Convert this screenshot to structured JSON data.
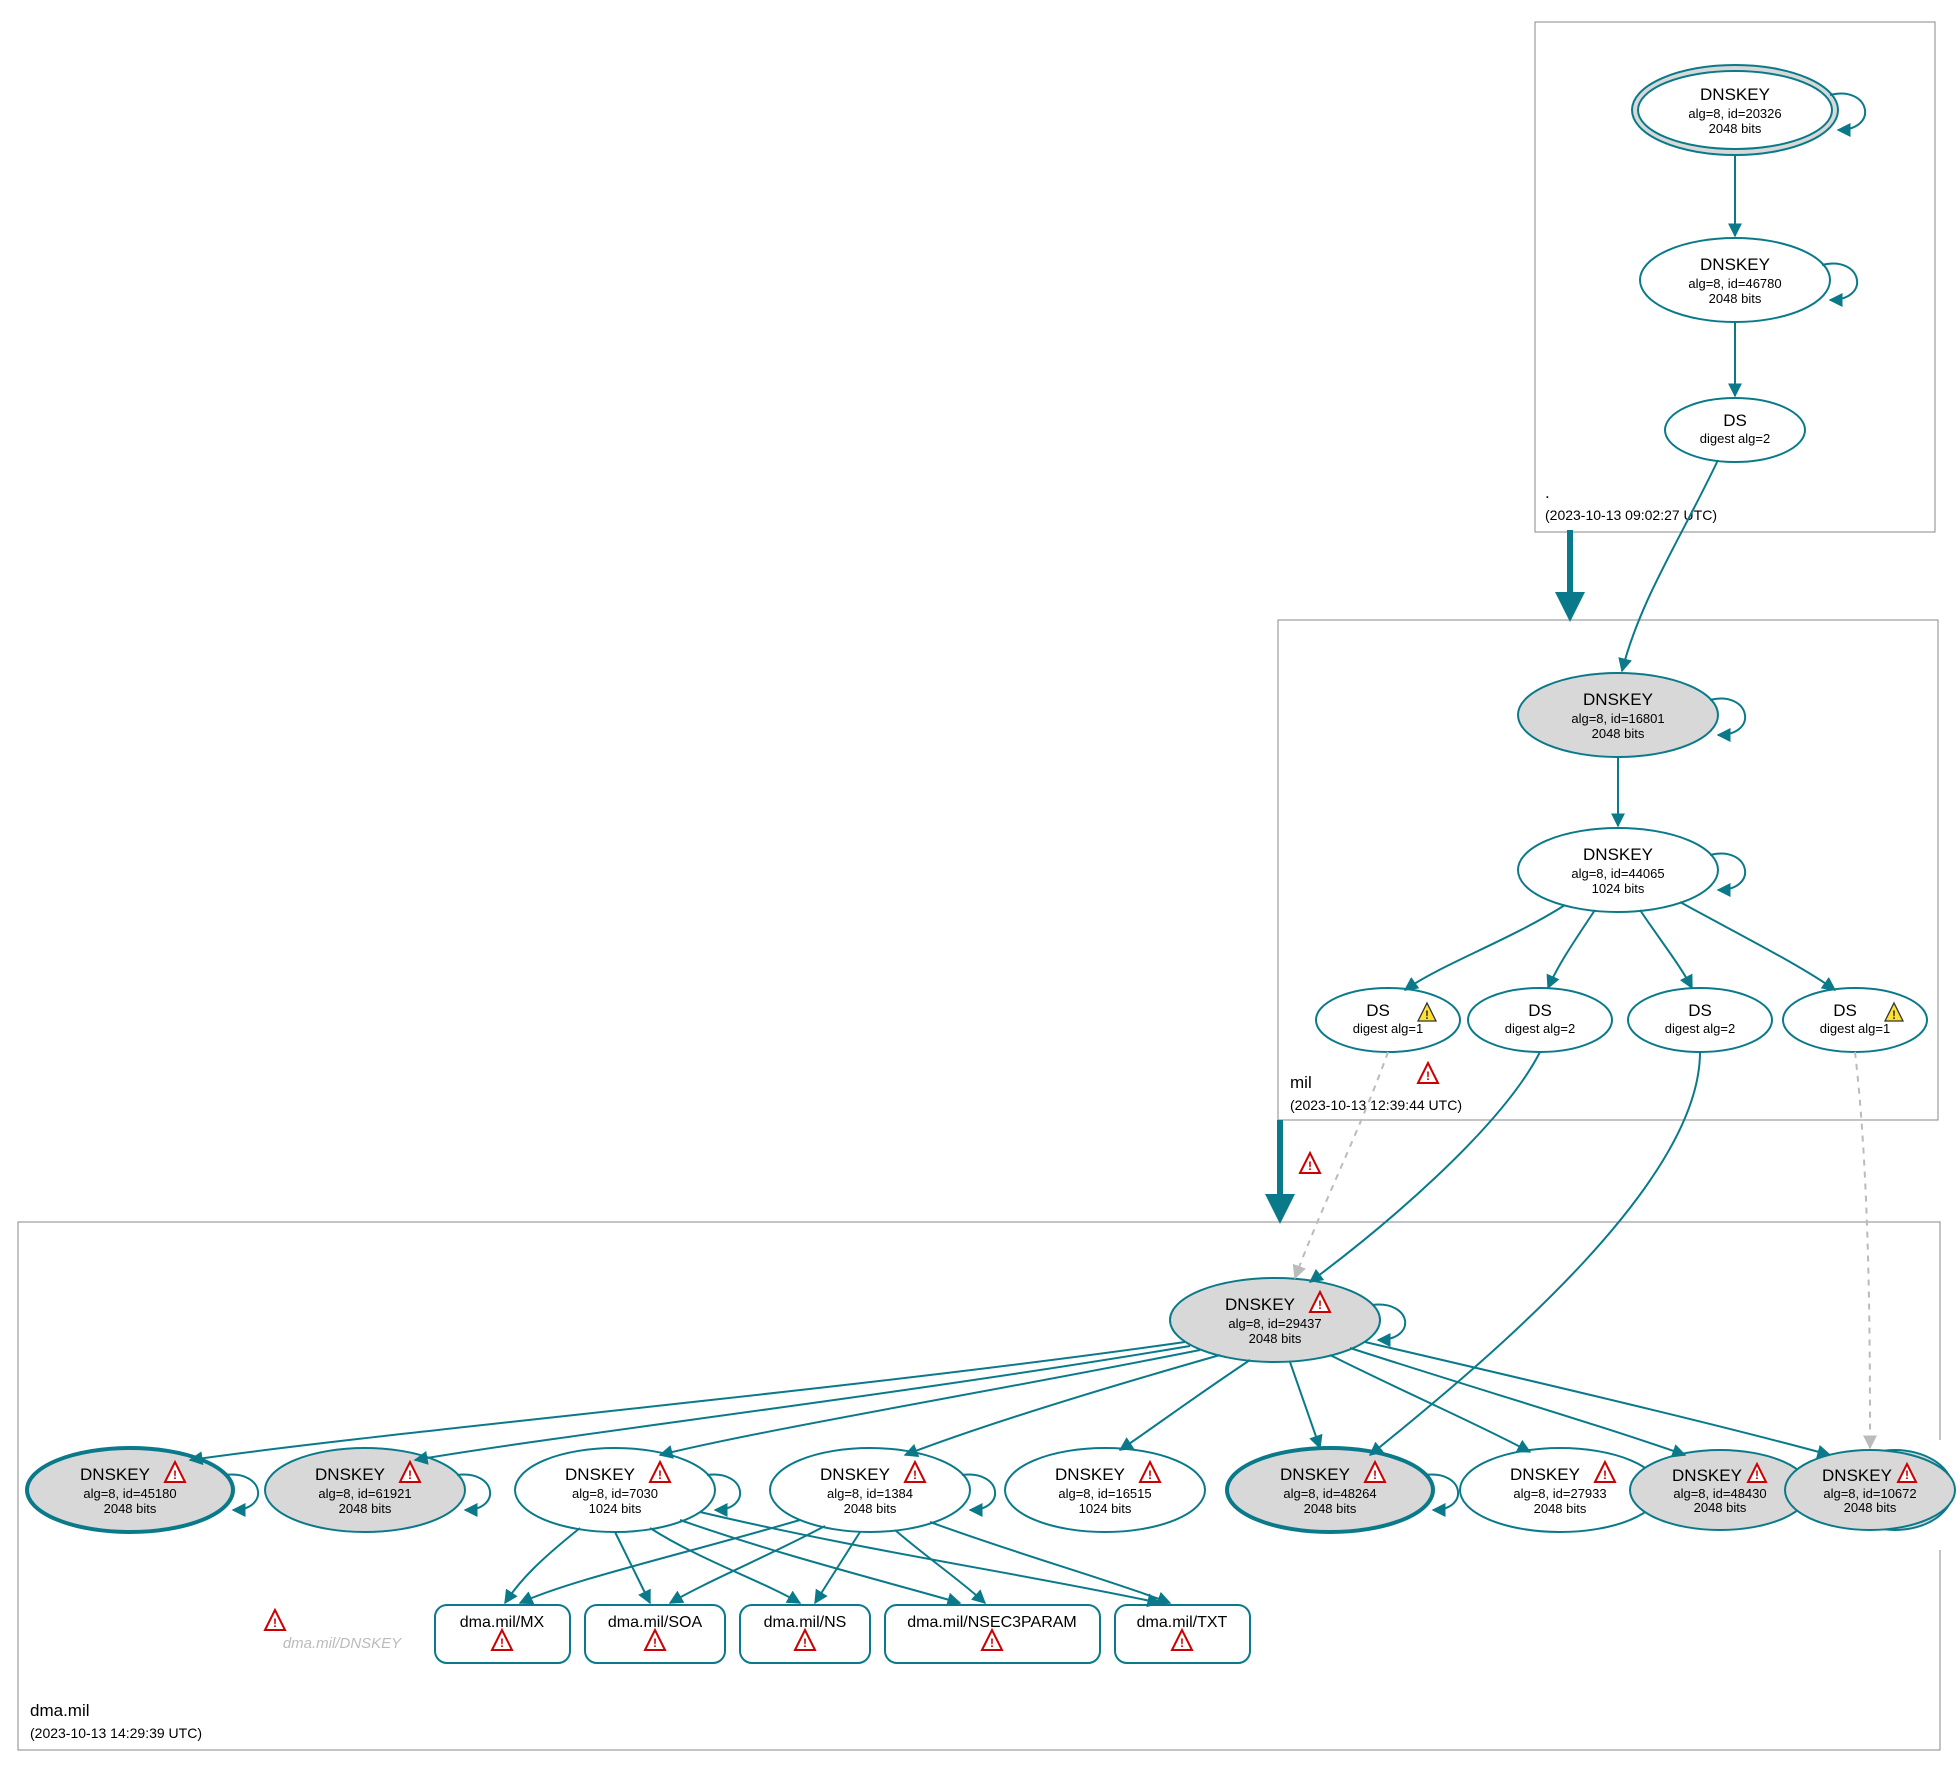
{
  "colors": {
    "stroke": "#0a7a8a",
    "shade": "#d8d8d8",
    "warn_red": "#c01818",
    "warn_yellow": "#ffe033"
  },
  "zones": {
    "root": {
      "name": ".",
      "timestamp": "(2023-10-13 09:02:27 UTC)"
    },
    "mil": {
      "name": "mil",
      "timestamp": "(2023-10-13 12:39:44 UTC)"
    },
    "dmamil": {
      "name": "dma.mil",
      "timestamp": "(2023-10-13 14:29:39 UTC)"
    }
  },
  "nodes": {
    "root_ksk": {
      "title": "DNSKEY",
      "line2": "alg=8, id=20326",
      "line3": "2048 bits",
      "warn": null
    },
    "root_zsk": {
      "title": "DNSKEY",
      "line2": "alg=8, id=46780",
      "line3": "2048 bits",
      "warn": null
    },
    "root_ds": {
      "title": "DS",
      "line2": "digest alg=2",
      "line3": "",
      "warn": null
    },
    "mil_ksk": {
      "title": "DNSKEY",
      "line2": "alg=8, id=16801",
      "line3": "2048 bits",
      "warn": null
    },
    "mil_zsk": {
      "title": "DNSKEY",
      "line2": "alg=8, id=44065",
      "line3": "1024 bits",
      "warn": null
    },
    "mil_ds1": {
      "title": "DS",
      "line2": "digest alg=1",
      "line3": "",
      "warn": "yellow"
    },
    "mil_ds2": {
      "title": "DS",
      "line2": "digest alg=2",
      "line3": "",
      "warn": null
    },
    "mil_ds3": {
      "title": "DS",
      "line2": "digest alg=2",
      "line3": "",
      "warn": null
    },
    "mil_ds4": {
      "title": "DS",
      "line2": "digest alg=1",
      "line3": "",
      "warn": "yellow"
    },
    "dma_ksk": {
      "title": "DNSKEY",
      "line2": "alg=8, id=29437",
      "line3": "2048 bits",
      "warn": "red"
    },
    "dma_k45180": {
      "title": "DNSKEY",
      "line2": "alg=8, id=45180",
      "line3": "2048 bits",
      "warn": "red"
    },
    "dma_k61921": {
      "title": "DNSKEY",
      "line2": "alg=8, id=61921",
      "line3": "2048 bits",
      "warn": "red"
    },
    "dma_k7030": {
      "title": "DNSKEY",
      "line2": "alg=8, id=7030",
      "line3": "1024 bits",
      "warn": "red"
    },
    "dma_k1384": {
      "title": "DNSKEY",
      "line2": "alg=8, id=1384",
      "line3": "2048 bits",
      "warn": "red"
    },
    "dma_k16515": {
      "title": "DNSKEY",
      "line2": "alg=8, id=16515",
      "line3": "1024 bits",
      "warn": "red"
    },
    "dma_k48264": {
      "title": "DNSKEY",
      "line2": "alg=8, id=48264",
      "line3": "2048 bits",
      "warn": "red"
    },
    "dma_k27933": {
      "title": "DNSKEY",
      "line2": "alg=8, id=27933",
      "line3": "2048 bits",
      "warn": "red"
    },
    "dma_k48430": {
      "title": "DNSKEY",
      "line2": "alg=8, id=48430",
      "line3": "2048 bits",
      "warn": "red"
    },
    "dma_k10672": {
      "title": "DNSKEY",
      "line2": "alg=8, id=10672",
      "line3": "2048 bits",
      "warn": "red"
    }
  },
  "rrsets": {
    "mx": {
      "label": "dma.mil/MX"
    },
    "soa": {
      "label": "dma.mil/SOA"
    },
    "ns": {
      "label": "dma.mil/NS"
    },
    "nsec": {
      "label": "dma.mil/NSEC3PARAM"
    },
    "txt": {
      "label": "dma.mil/TXT"
    }
  },
  "phantom": {
    "label": "dma.mil/DNSKEY"
  },
  "floating_warnings": [
    {
      "id": "mil-zone-warn"
    },
    {
      "id": "deleg-warn"
    }
  ]
}
